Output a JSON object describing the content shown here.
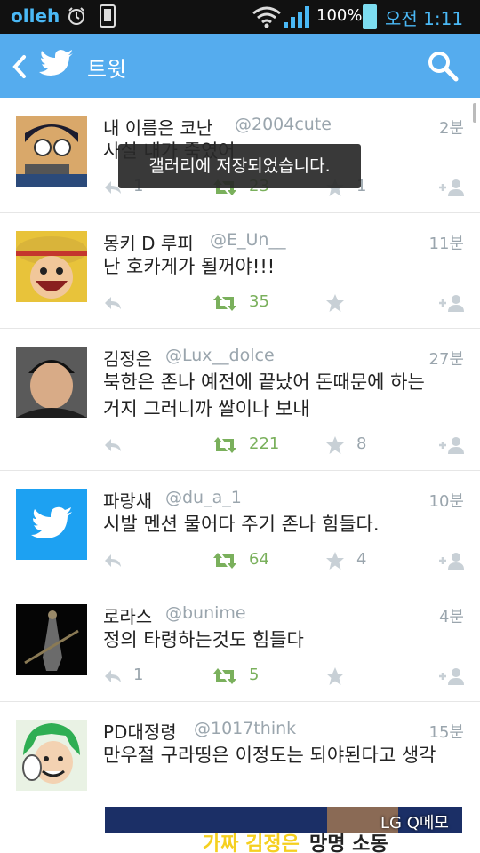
{
  "status_bar": {
    "carrier": "olleh",
    "battery": "100%",
    "time": "오전 1:11"
  },
  "header": {
    "title": "트윗"
  },
  "toast": "갤러리에 저장되었습니다.",
  "tweets": [
    {
      "name": "내 이름은 코난",
      "handle": "@2004cute",
      "time": "2분",
      "text": "사실 내가 죽였어",
      "reply_count": "1",
      "retweet_count": "23",
      "favorite_count": "1"
    },
    {
      "name": "몽키 D 루피",
      "handle": "@E_Un__",
      "time": "11분",
      "text": "난 호카게가 될꺼야!!!",
      "reply_count": "",
      "retweet_count": "35",
      "favorite_count": ""
    },
    {
      "name": "김정은",
      "handle": "@Lux__dolce",
      "time": "27분",
      "text": "북한은 존나 예전에 끝났어 돈때문에 하는거지 그러니까 쌀이나 보내",
      "reply_count": "",
      "retweet_count": "221",
      "favorite_count": "8"
    },
    {
      "name": "파랑새",
      "handle": "@du_a_1",
      "time": "10분",
      "text": "시발 멘션 물어다 주기 존나 힘들다.",
      "reply_count": "",
      "retweet_count": "64",
      "favorite_count": "4"
    },
    {
      "name": "로라스",
      "handle": "@bunime",
      "time": "4분",
      "text": "정의 타령하는것도 힘들다",
      "reply_count": "1",
      "retweet_count": "5",
      "favorite_count": ""
    },
    {
      "name": "PD대정령",
      "handle": "@1017think",
      "time": "15분",
      "text": "만우절 구라띵은 이정도는 되야된다고 생각",
      "reply_count": "",
      "retweet_count": "",
      "favorite_count": ""
    }
  ],
  "media": {
    "headline_yellow": "가짜 김정은",
    "headline_dark": "망명 소동"
  },
  "watermark": "LG Q메모",
  "colors": {
    "header": "#55acee",
    "retweet": "#7ab05c",
    "muted": "#9aa5ad"
  }
}
